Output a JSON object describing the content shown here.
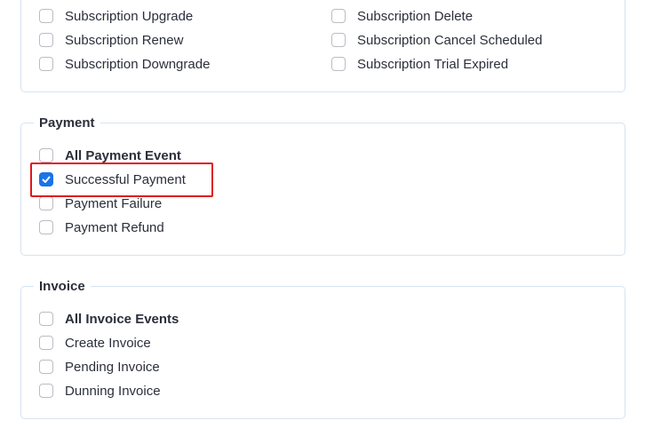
{
  "subscription": {
    "left": [
      {
        "label": "Subscription Upgrade",
        "checked": false
      },
      {
        "label": "Subscription Renew",
        "checked": false
      },
      {
        "label": "Subscription Downgrade",
        "checked": false
      }
    ],
    "right": [
      {
        "label": "Subscription Delete",
        "checked": false
      },
      {
        "label": "Subscription Cancel Scheduled",
        "checked": false
      },
      {
        "label": "Subscription Trial Expired",
        "checked": false
      }
    ]
  },
  "payment": {
    "title": "Payment",
    "items": [
      {
        "label": "All Payment Event",
        "checked": false,
        "bold": true
      },
      {
        "label": "Successful Payment",
        "checked": true,
        "bold": false
      },
      {
        "label": "Payment Failure",
        "checked": false,
        "bold": false
      },
      {
        "label": "Payment Refund",
        "checked": false,
        "bold": false
      }
    ]
  },
  "invoice": {
    "title": "Invoice",
    "items": [
      {
        "label": "All Invoice Events",
        "checked": false,
        "bold": true
      },
      {
        "label": "Create Invoice",
        "checked": false,
        "bold": false
      },
      {
        "label": "Pending Invoice",
        "checked": false,
        "bold": false
      },
      {
        "label": "Dunning Invoice",
        "checked": false,
        "bold": false
      }
    ]
  },
  "colors": {
    "accent": "#1a73e8",
    "highlight": "#e0161e",
    "border": "#d6e3f0"
  }
}
